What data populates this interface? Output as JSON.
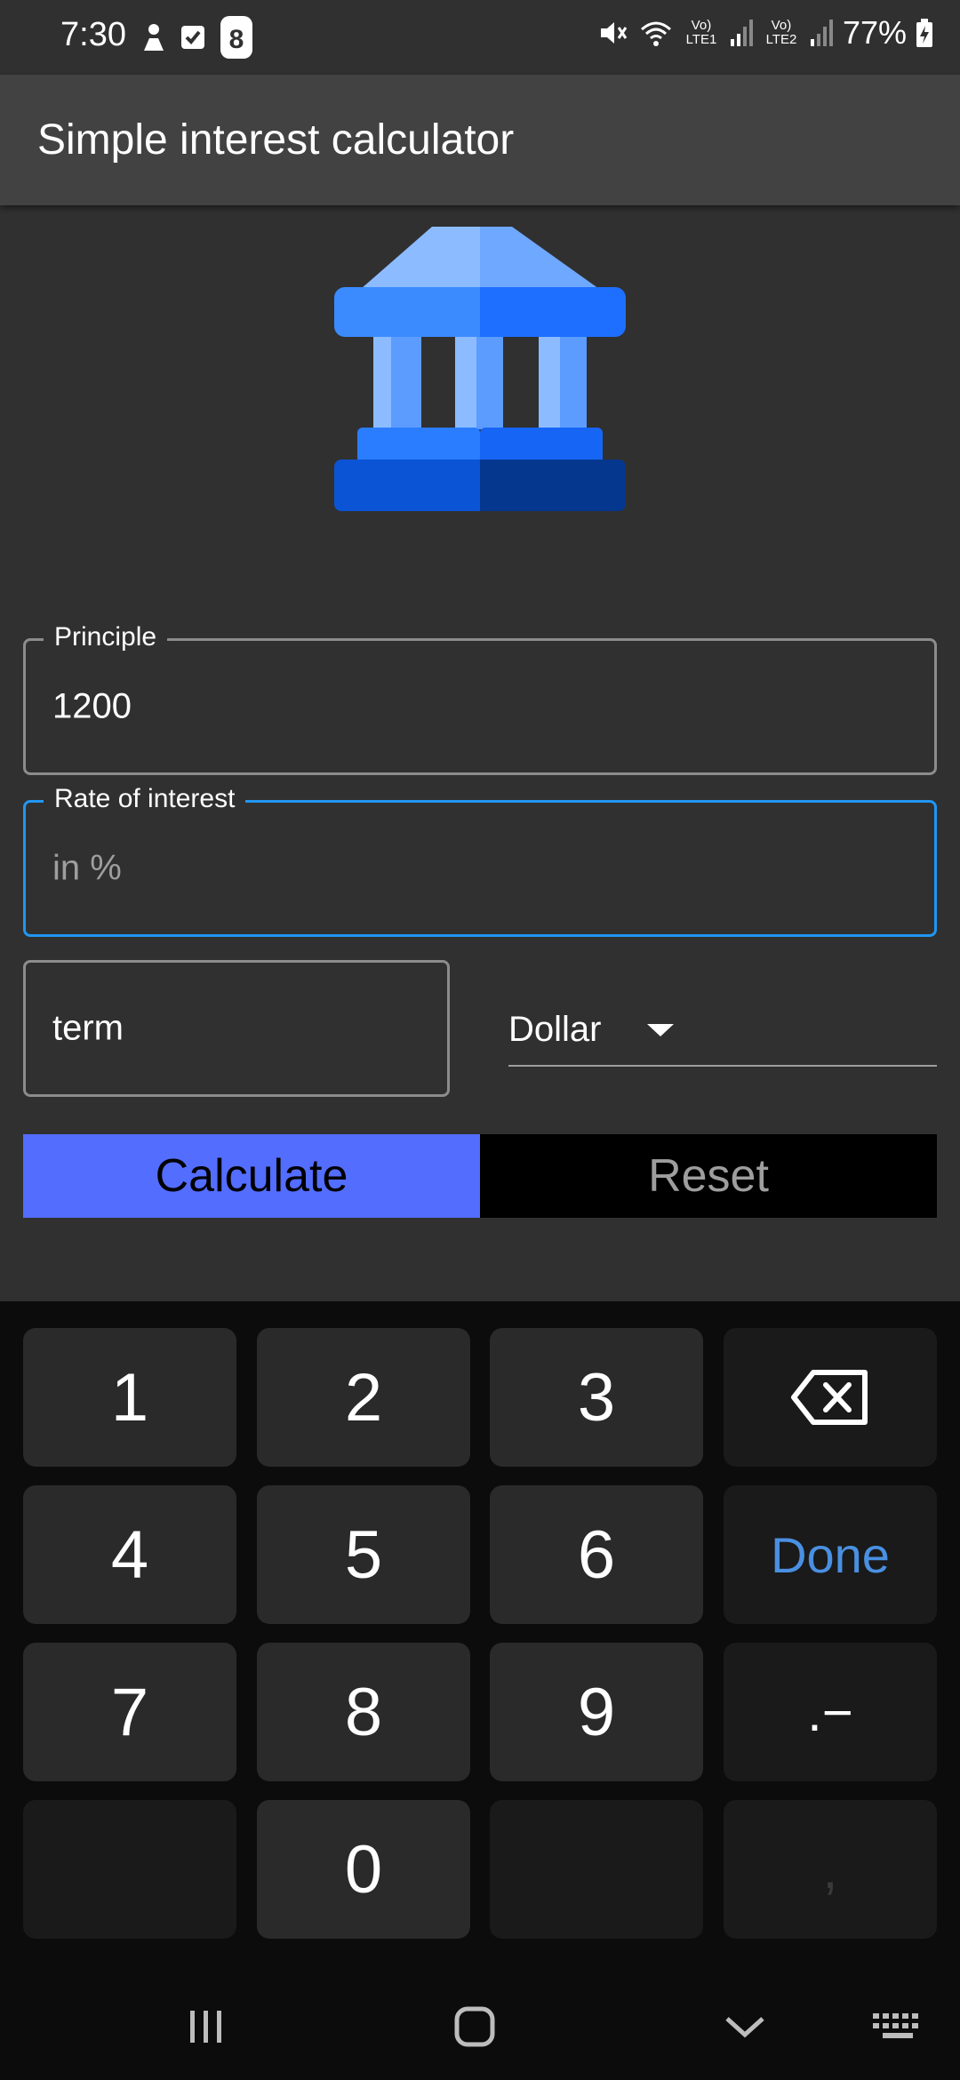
{
  "status_bar": {
    "time": "7:30",
    "battery": "77%",
    "network_1": "Vo) LTE1",
    "network_2": "Vo) LTE2"
  },
  "app_bar": {
    "title": "Simple interest calculator"
  },
  "form": {
    "principle": {
      "label": "Principle",
      "value": "1200"
    },
    "rate": {
      "label": "Rate of interest",
      "placeholder": "in %"
    },
    "term": {
      "placeholder": "term"
    },
    "currency": {
      "selected": "Dollar"
    }
  },
  "buttons": {
    "calculate": "Calculate",
    "reset": "Reset"
  },
  "keyboard": {
    "keys": [
      "1",
      "2",
      "3",
      "4",
      "5",
      "6",
      "Done",
      "7",
      "8",
      "9",
      ".−",
      "0",
      ","
    ]
  },
  "colors": {
    "accent_blue": "#2196f3",
    "calculate_button": "#536dfe",
    "done_key": "#4a90e2",
    "background": "#303030",
    "app_bar": "#424242"
  }
}
